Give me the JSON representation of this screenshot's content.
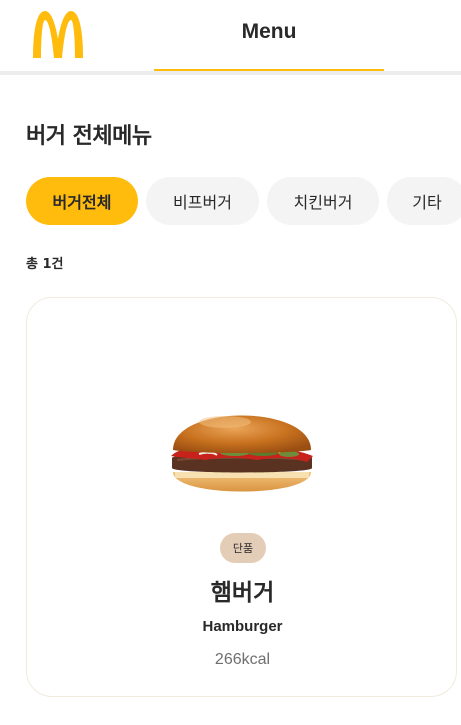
{
  "header": {
    "logo": "mcdonalds-golden-arches-logo",
    "tab_label": "Menu",
    "accent_color": "#ffbc0d"
  },
  "section": {
    "title": "버거 전체메뉴"
  },
  "filters": [
    {
      "label": "버거전체",
      "active": true
    },
    {
      "label": "비프버거",
      "active": false
    },
    {
      "label": "치킨버거",
      "active": false
    },
    {
      "label": "기타",
      "active": false
    }
  ],
  "results": {
    "total_label": "총 1건"
  },
  "products": [
    {
      "image": "hamburger-image",
      "badge": "단품",
      "name_ko": "햄버거",
      "name_en": "Hamburger",
      "kcal": "266kcal"
    }
  ]
}
